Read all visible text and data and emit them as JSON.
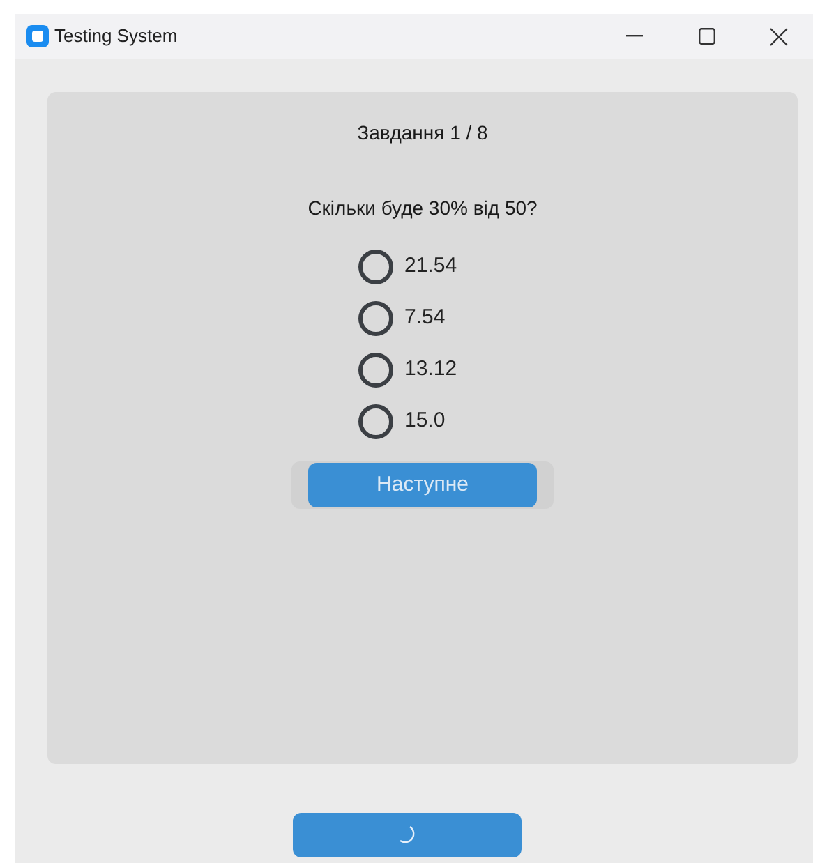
{
  "window": {
    "title": "Testing System"
  },
  "task_counter": "Завдання 1 / 8",
  "question": "Скільки буде 30% від 50?",
  "options": [
    {
      "label": "21.54",
      "selected": false
    },
    {
      "label": "7.54",
      "selected": false
    },
    {
      "label": "13.12",
      "selected": false
    },
    {
      "label": "15.0",
      "selected": false
    }
  ],
  "next_button": "Наступне"
}
